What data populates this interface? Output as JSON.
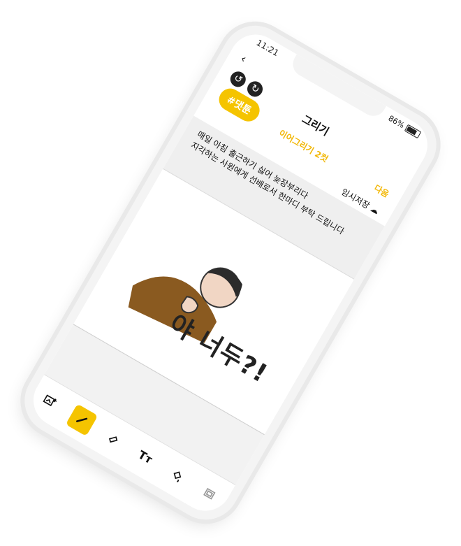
{
  "status": {
    "time": "11:21",
    "battery": "86%"
  },
  "header": {
    "title": "그리기"
  },
  "subheader": {
    "continue_title": "이어그리기 2컷",
    "next_label": "다음"
  },
  "tag": {
    "label": "#댓툰"
  },
  "actions": {
    "temp_save": "임시저장"
  },
  "prompt": {
    "line1": "매일 아침 출근하기 싫어 늦장부리다",
    "line2": "지각하는 사원에게 선배로서 한마디 부탁 드립니다"
  },
  "canvas": {
    "caption": "야 너두?!"
  },
  "toolbar": {
    "text_tool": "Tт"
  }
}
